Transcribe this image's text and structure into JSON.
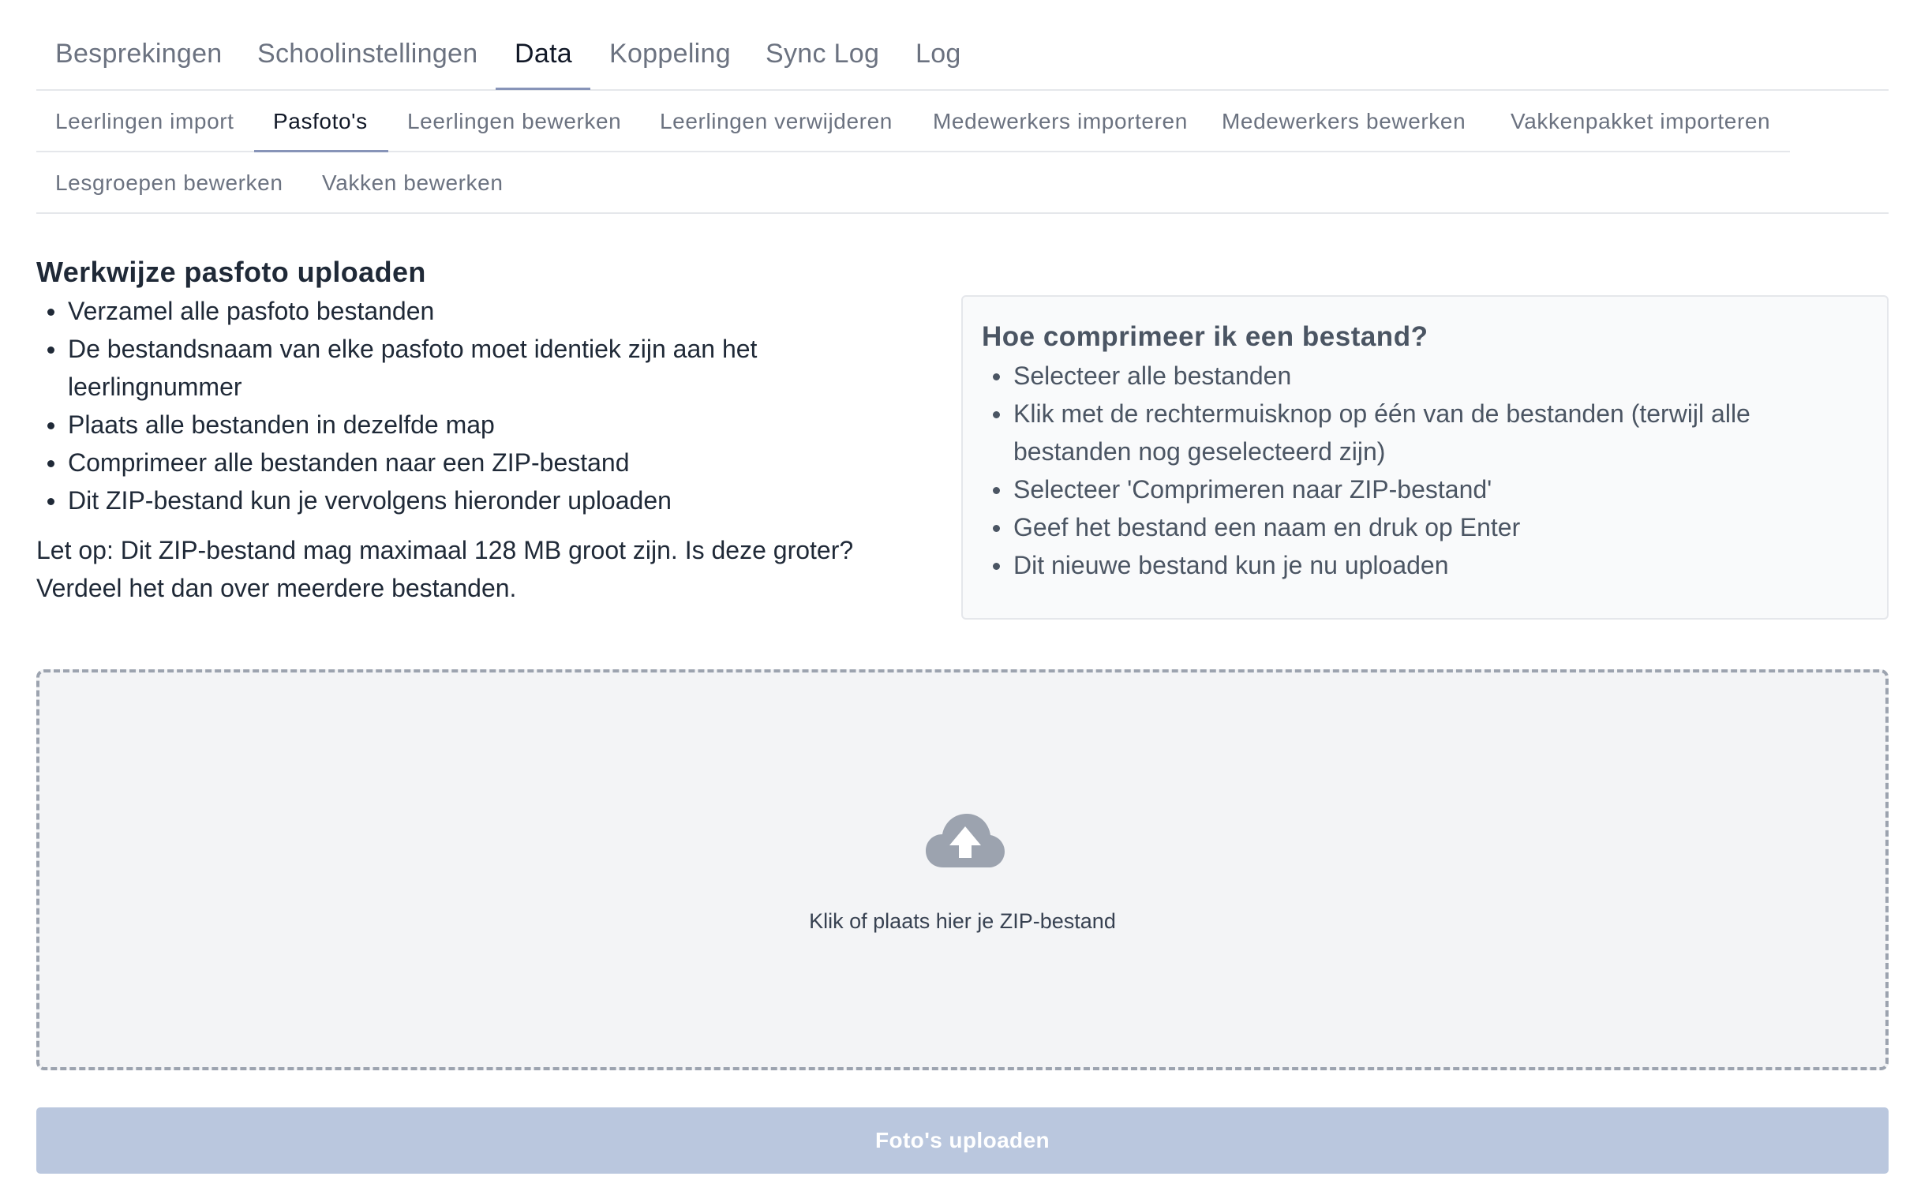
{
  "main_tabs": [
    {
      "label": "Besprekingen"
    },
    {
      "label": "Schoolinstellingen"
    },
    {
      "label": "Data",
      "active": true
    },
    {
      "label": "Koppeling"
    },
    {
      "label": "Sync Log"
    },
    {
      "label": "Log"
    }
  ],
  "sub_tabs": [
    {
      "label": "Leerlingen import"
    },
    {
      "label": "Pasfoto's",
      "active": true
    },
    {
      "label": "Leerlingen bewerken"
    },
    {
      "label": "Leerlingen verwijderen"
    },
    {
      "label": "Medewerkers importeren"
    },
    {
      "label": "Medewerkers bewerken"
    },
    {
      "label": "Vakkenpakket importeren"
    },
    {
      "label": "Lesgroepen bewerken"
    },
    {
      "label": "Vakken bewerken"
    }
  ],
  "instructions": {
    "title": "Werkwijze pasfoto uploaden",
    "steps": [
      "Verzamel alle pasfoto bestanden",
      "De bestandsnaam van elke pasfoto moet identiek zijn aan het leerlingnummer",
      "Plaats alle bestanden in dezelfde map",
      "Comprimeer alle bestanden naar een ZIP-bestand",
      "Dit ZIP-bestand kun je vervolgens hieronder uploaden"
    ],
    "note": "Let op: Dit ZIP-bestand mag maximaal 128 MB groot zijn. Is deze groter? Verdeel het dan over meerdere bestanden."
  },
  "compress_help": {
    "title": "Hoe comprimeer ik een bestand?",
    "steps": [
      "Selecteer alle bestanden",
      "Klik met de rechtermuisknop op één van de bestanden (terwijl alle bestanden nog geselecteerd zijn)",
      "Selecteer 'Comprimeren naar ZIP-bestand'",
      "Geef het bestand een naam en druk op Enter",
      "Dit nieuwe bestand kun je nu uploaden"
    ]
  },
  "dropzone": {
    "icon": "cloud-upload-icon",
    "text": "Klik of plaats hier je ZIP-bestand"
  },
  "upload_button": {
    "label": "Foto's uploaden",
    "color": "#bac7de"
  },
  "colors": {
    "accent_underline": "#8794b8",
    "tab_inactive": "#6b7280",
    "tab_active": "#111827"
  }
}
